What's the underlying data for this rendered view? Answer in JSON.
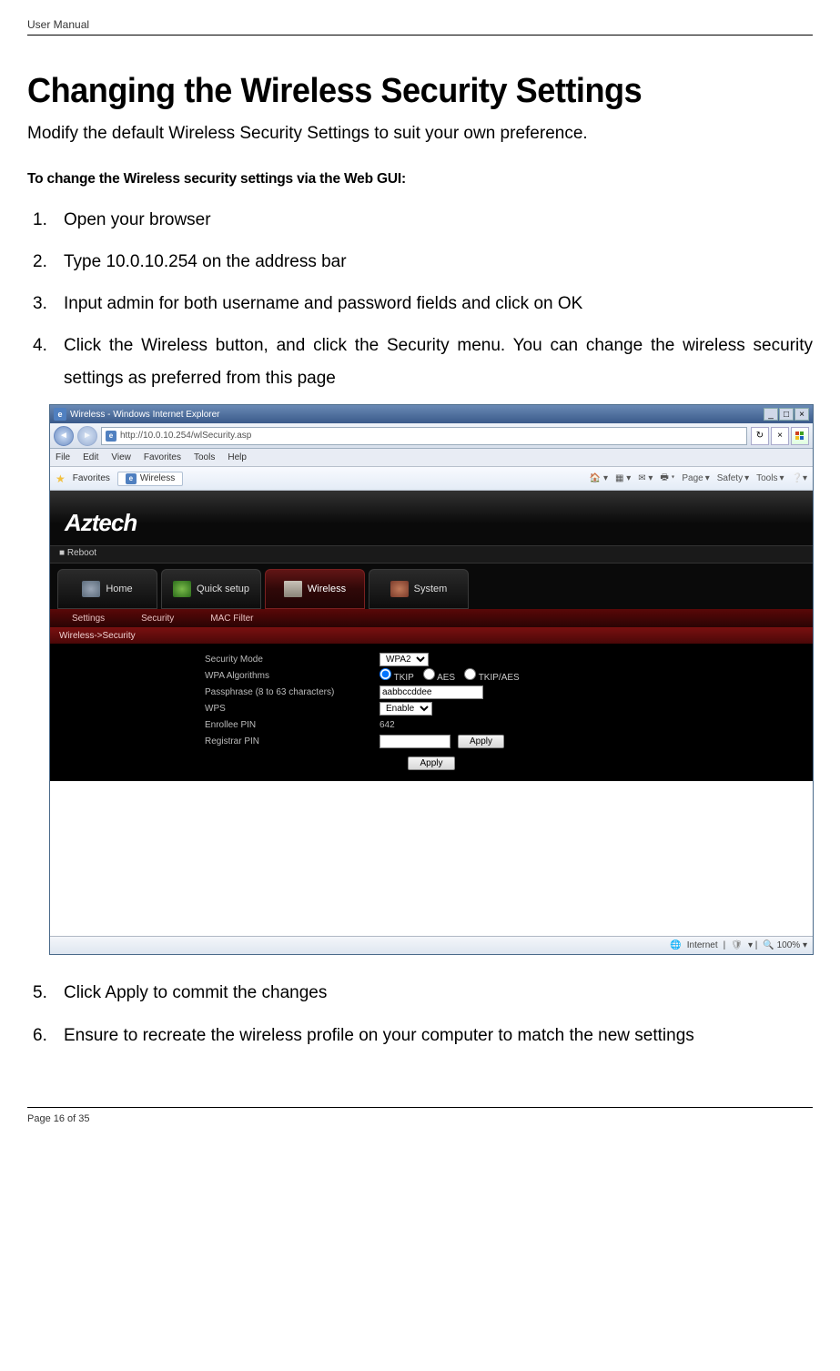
{
  "doc": {
    "header_label": "User Manual",
    "title": "Changing the Wireless Security Settings",
    "intro": "Modify the default Wireless Security Settings to suit your own preference.",
    "subheading": "To change the Wireless security settings via the Web GUI:",
    "steps": {
      "s1": "Open your browser",
      "s2": "Type 10.0.10.254 on the address bar",
      "s3": "Input admin for both username and password fields and click on OK",
      "s4": "Click the Wireless button, and click the Security menu. You can change the wireless security settings as preferred from this page",
      "s5": "Click Apply to commit the changes",
      "s6": "Ensure to recreate the wireless profile on your computer to match the new settings"
    },
    "footer": "Page 16 of 35"
  },
  "shot": {
    "window_title": "Wireless - Windows Internet Explorer",
    "address": "http://10.0.10.254/wlSecurity.asp",
    "menu": {
      "file": "File",
      "edit": "Edit",
      "view": "View",
      "fav": "Favorites",
      "tools": "Tools",
      "help": "Help"
    },
    "fav_label": "Favorites",
    "tab_title": "Wireless",
    "toolbar": {
      "page": "Page",
      "safety": "Safety",
      "tools": "Tools"
    },
    "brand": "Aztech",
    "reboot": "Reboot",
    "tabs": {
      "home": "Home",
      "quick": "Quick setup",
      "wireless": "Wireless",
      "system": "System"
    },
    "subtabs": {
      "settings": "Settings",
      "security": "Security",
      "mac": "MAC Filter"
    },
    "breadcrumb": "Wireless->Security",
    "form": {
      "secmode_label": "Security Mode",
      "secmode_value": "WPA2",
      "wpa_label": "WPA Algorithms",
      "alg_tkip": "TKIP",
      "alg_aes": "AES",
      "alg_both": "TKIP/AES",
      "pass_label": "Passphrase (8 to 63 characters)",
      "pass_value": "aabbccddee",
      "wps_label": "WPS",
      "wps_value": "Enable",
      "enrollee_label": "Enrollee PIN",
      "enrollee_value": "642",
      "registrar_label": "Registrar PIN",
      "registrar_value": "",
      "apply": "Apply"
    },
    "status": {
      "zone": "Internet",
      "zoom": "100%"
    }
  }
}
